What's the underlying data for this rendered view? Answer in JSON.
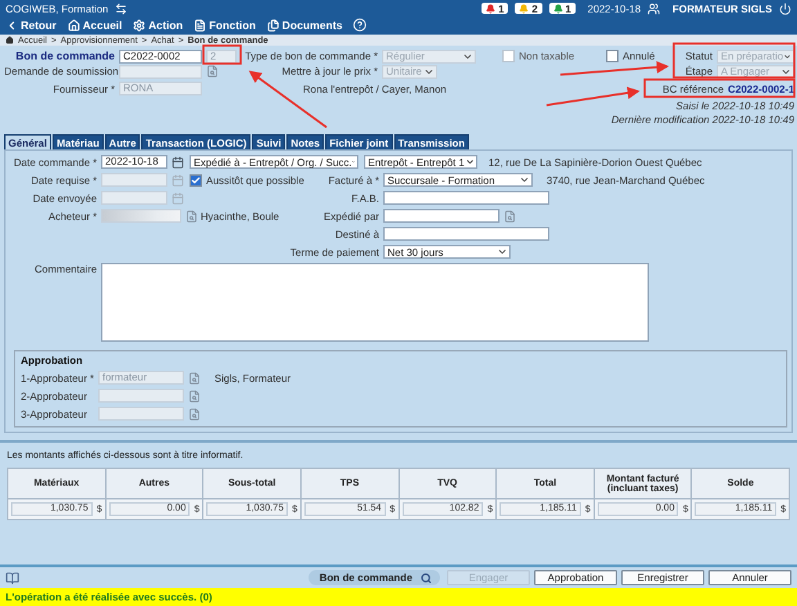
{
  "app": {
    "title": "COGIWEB, Formation"
  },
  "alerts": [
    {
      "count": "1",
      "color": "#e02828"
    },
    {
      "count": "2",
      "color": "#f2b705"
    },
    {
      "count": "1",
      "color": "#22a244"
    }
  ],
  "date": "2022-10-18",
  "user": "FORMATEUR SIGLS",
  "nav": [
    {
      "label": "Retour",
      "kind": "back"
    },
    {
      "label": "Accueil",
      "kind": "home"
    },
    {
      "label": "Action",
      "kind": "action"
    },
    {
      "label": "Fonction",
      "kind": "function"
    },
    {
      "label": "Documents",
      "kind": "documents"
    }
  ],
  "breadcrumb": {
    "separator": ">",
    "items": [
      "Accueil",
      "Approvisionnement",
      "Achat",
      "Bon de commande"
    ]
  },
  "header": {
    "order": {
      "label": "Bon de commande",
      "value": "C2022-0002",
      "revision": "2"
    },
    "quote_request": {
      "label": "Demande de soumission",
      "disabled": true
    },
    "supplier": {
      "label": "Fournisseur *",
      "value": "RONA",
      "disabled": true,
      "info": "Rona l'entrepôt / Cayer, Manon"
    },
    "po_type": {
      "label": "Type de bon de commande *",
      "value": "Régulier",
      "disabled": true
    },
    "price_update": {
      "label": "Mettre à jour le prix *",
      "value": "Unitaire",
      "disabled": true
    },
    "non_taxable": {
      "label": "Non taxable",
      "checked": false,
      "disabled": true
    },
    "cancelled": {
      "label": "Annulé",
      "checked": false,
      "disabled": false
    },
    "status": {
      "label": "Statut",
      "value": "En préparatio",
      "disabled": true
    },
    "stage": {
      "label": "Étape",
      "value": "A Engager",
      "disabled": true
    },
    "reference": {
      "label": "BC référence",
      "value": "C2022-0002-1"
    },
    "entered": "Saisi le 2022-10-18 10:49",
    "modified": "Dernière modification 2022-10-18 10:49"
  },
  "tabs": [
    {
      "label": "Général",
      "selected": true
    },
    {
      "label": "Matériau",
      "selected": false
    },
    {
      "label": "Autre",
      "selected": false
    },
    {
      "label": "Transaction (LOGIC)",
      "selected": false
    },
    {
      "label": "Suivi",
      "selected": false
    },
    {
      "label": "Notes",
      "selected": false
    },
    {
      "label": "Fichier joint",
      "selected": false
    },
    {
      "label": "Transmission",
      "selected": false
    }
  ],
  "general": {
    "order_date": {
      "label": "Date commande *",
      "value": "2022-10-18",
      "disabled": false
    },
    "ship_to": {
      "type": "Expédié à - Entrepôt / Org. / Succ.",
      "location": "Entrepôt - Entrepôt 1",
      "address": "12, rue De La Sapinière-Dorion Ouest Québec"
    },
    "required_date": {
      "label": "Date requise *",
      "disabled": true
    },
    "asap": {
      "label": "Aussitôt que possible",
      "checked": true
    },
    "bill_to": {
      "label": "Facturé à *",
      "value": "Succursale - Formation",
      "address": "3740, rue Jean-Marchand Québec"
    },
    "sent_date": {
      "label": "Date envoyée",
      "disabled": true
    },
    "fob": {
      "label": "F.A.B."
    },
    "buyer": {
      "label": "Acheteur *",
      "name": "Hyacinthe, Boule"
    },
    "shipped_by": {
      "label": "Expédié par"
    },
    "destined": {
      "label": "Destiné à"
    },
    "payment_terms": {
      "label": "Terme de paiement",
      "value": "Net 30 jours"
    },
    "comment": {
      "label": "Commentaire"
    }
  },
  "approval": {
    "title": "Approbation",
    "approvers": [
      {
        "label": "1-Approbateur *",
        "value": "formateur",
        "name": "Sigls, Formateur"
      },
      {
        "label": "2-Approbateur"
      },
      {
        "label": "3-Approbateur"
      }
    ]
  },
  "amounts_note": "Les montants affichés ci-dessous sont à titre informatif.",
  "totals": {
    "currency": "$",
    "columns": [
      {
        "label": "Matériaux",
        "value": "1,030.75"
      },
      {
        "label": "Autres",
        "value": "0.00"
      },
      {
        "label": "Sous-total",
        "value": "1,030.75"
      },
      {
        "label": "TPS",
        "value": "51.54"
      },
      {
        "label": "TVQ",
        "value": "102.82"
      },
      {
        "label": "Total",
        "value": "1,185.11"
      },
      {
        "label": "Montant facturé (incluant taxes)",
        "value": "0.00"
      },
      {
        "label": "Solde",
        "value": "1,185.11"
      }
    ]
  },
  "footer": {
    "report": "Bon de commande",
    "buttons": [
      {
        "label": "Engager",
        "disabled": true
      },
      {
        "label": "Approbation",
        "disabled": false
      },
      {
        "label": "Enregistrer",
        "disabled": false
      },
      {
        "label": "Annuler",
        "disabled": false
      }
    ]
  },
  "status_message": "L'opération a été réalisée avec succès. (0)"
}
